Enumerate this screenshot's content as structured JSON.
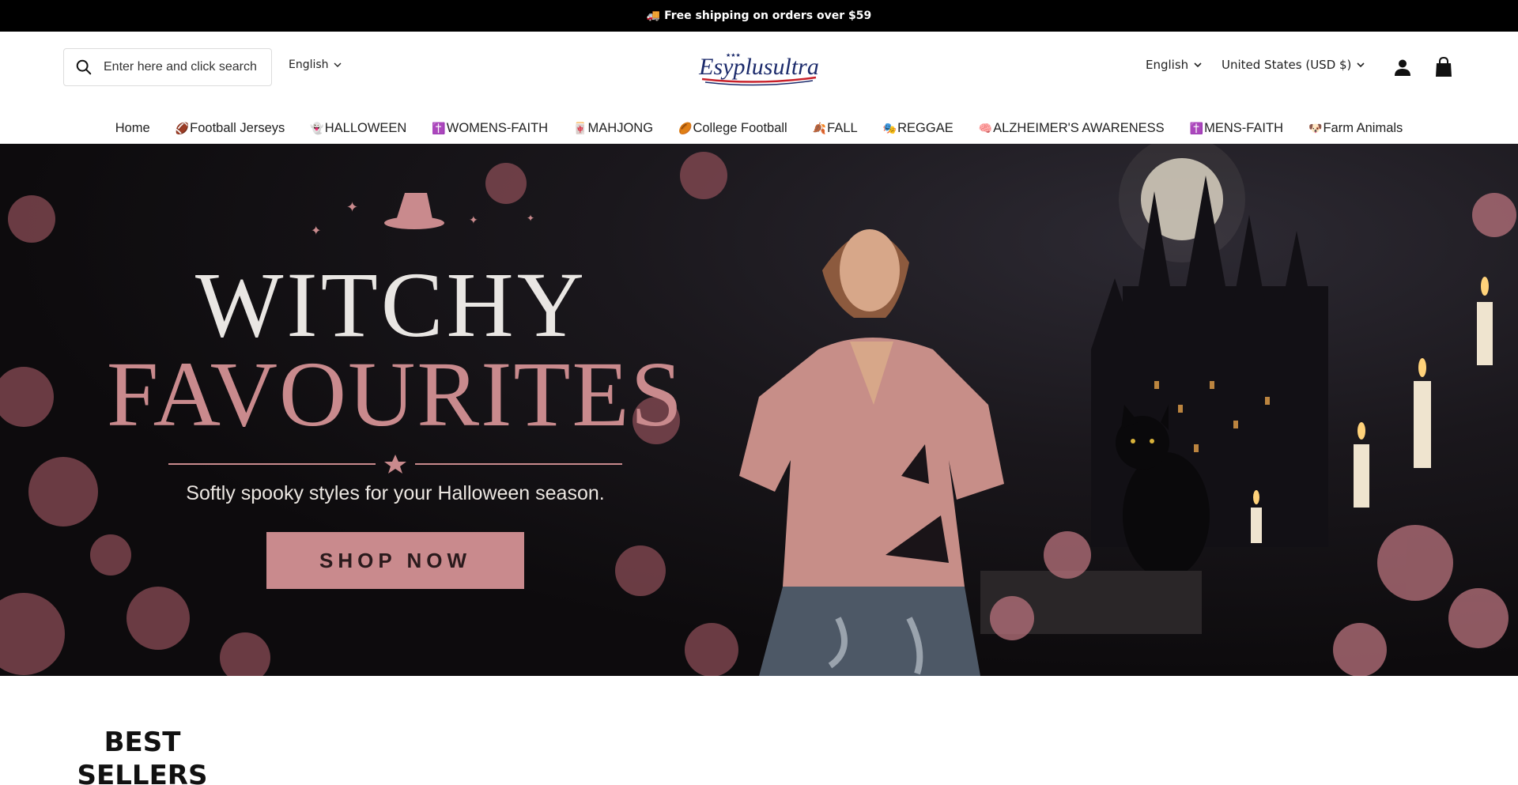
{
  "announcement": {
    "icon": "truck-icon",
    "text": "🚚 Free shipping on orders over $59"
  },
  "header": {
    "search_placeholder": "Enter here and click search",
    "language_left": "English",
    "logo_text": "Esyplusultra",
    "language_right": "English",
    "currency": "United States (USD $)"
  },
  "nav": {
    "items": [
      {
        "emoji": "",
        "label": "Home"
      },
      {
        "emoji": "🏈",
        "label": "Football Jerseys"
      },
      {
        "emoji": "👻",
        "label": "HALLOWEEN"
      },
      {
        "emoji": "✝️",
        "label": "WOMENS-FAITH"
      },
      {
        "emoji": "🀄",
        "label": "MAHJONG"
      },
      {
        "emoji": "🏉",
        "label": "College Football"
      },
      {
        "emoji": "🍂",
        "label": "FALL"
      },
      {
        "emoji": "🎭",
        "label": "REGGAE"
      },
      {
        "emoji": "🧠",
        "label": "ALZHEIMER'S AWARENESS"
      },
      {
        "emoji": "✝️",
        "label": "MENS-FAITH"
      },
      {
        "emoji": "🐶",
        "label": "Farm Animals"
      }
    ]
  },
  "hero": {
    "title_line1": "WITCHY",
    "title_line2": "FAVOURITES",
    "subtitle": "Softly spooky styles for your Halloween season.",
    "button": "SHOP NOW"
  },
  "best_sellers": {
    "title": "BEST SELLERS"
  },
  "colors": {
    "accent_pink": "#c98a8d",
    "announce_bg": "#000000"
  }
}
